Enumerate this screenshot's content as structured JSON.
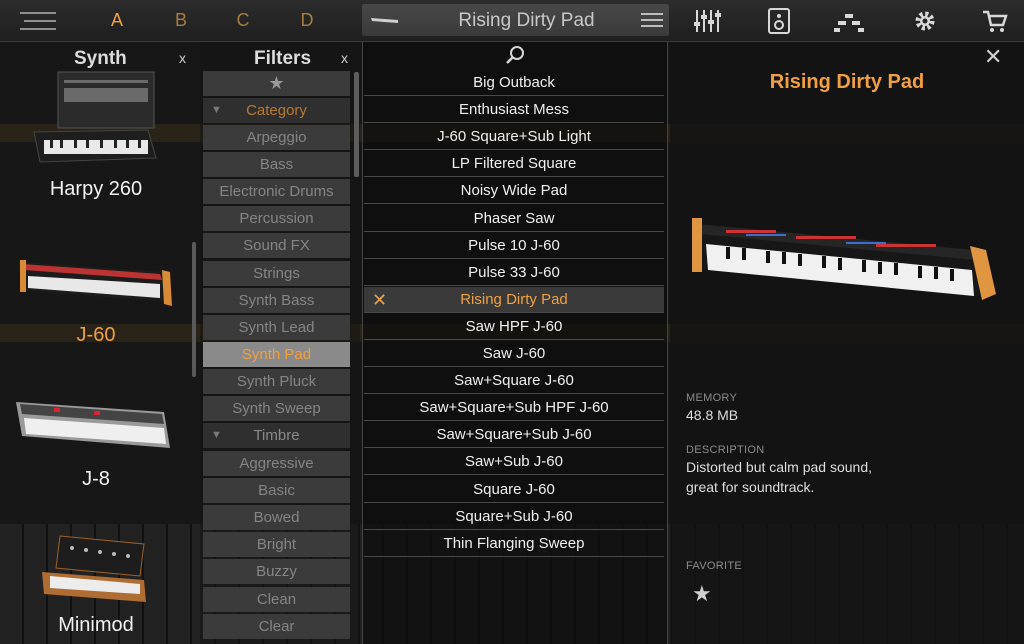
{
  "topbar": {
    "slots": [
      "A",
      "B",
      "C",
      "D"
    ],
    "preset_name": "Rising Dirty Pad",
    "icons": [
      "mixer-icon",
      "speaker-icon",
      "sequencer-icon",
      "settings-gear-icon",
      "shopping-cart-icon"
    ]
  },
  "synth_panel": {
    "title": "Synth",
    "close": "x",
    "items": [
      {
        "label": "Harpy 260",
        "active": false
      },
      {
        "label": "J-60",
        "active": true
      },
      {
        "label": "J-8",
        "active": false
      },
      {
        "label": "Minimod",
        "active": false
      }
    ]
  },
  "filters_panel": {
    "title": "Filters",
    "close": "x",
    "favorites_star": "★",
    "category_header": "Category",
    "categories": [
      "Arpeggio",
      "Bass",
      "Electronic Drums",
      "Percussion",
      "Sound FX",
      "Strings",
      "Synth Bass",
      "Synth Lead",
      "Synth Pad",
      "Synth Pluck",
      "Synth Sweep"
    ],
    "selected_category": "Synth Pad",
    "timbre_header": "Timbre",
    "timbres": [
      "Aggressive",
      "Basic",
      "Bowed",
      "Bright",
      "Buzzy",
      "Clean",
      "Clear"
    ]
  },
  "preset_list": {
    "items": [
      "Big Outback",
      "Enthusiast Mess",
      "J-60 Square+Sub Light",
      "LP Filtered Square",
      "Noisy Wide Pad",
      "Phaser Saw",
      "Pulse 10 J-60",
      "Pulse 33 J-60",
      "Rising Dirty Pad",
      "Saw HPF J-60",
      "Saw J-60",
      "Saw+Square J-60",
      "Saw+Square+Sub HPF J-60",
      "Saw+Square+Sub J-60",
      "Saw+Sub J-60",
      "Square J-60",
      "Square+Sub J-60",
      "Thin Flanging Sweep"
    ],
    "selected": "Rising Dirty Pad",
    "selected_mark": "✕"
  },
  "detail": {
    "close": "✕",
    "title": "Rising Dirty Pad",
    "memory_label": "MEMORY",
    "memory_value": "48.8 MB",
    "description_label": "DESCRIPTION",
    "description_line1": "Distorted but calm pad sound,",
    "description_line2": "great for soundtrack.",
    "favorite_label": "FAVORITE",
    "favorite_star": "★"
  },
  "colors": {
    "accent": "#f0a040",
    "panel": "#3b3b3b",
    "selected_filter": "#8a8a8a"
  }
}
